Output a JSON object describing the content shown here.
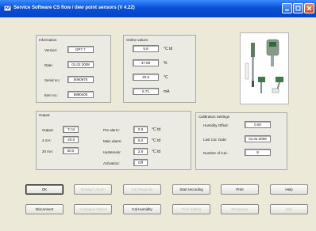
{
  "window": {
    "title": "Service Software CS flow / dew point sensors (V 4.22)"
  },
  "information": {
    "title": "Information",
    "version_label": "Version:",
    "version_value": "DP7.7",
    "date_label": "Date:",
    "date_value": "01.02.2008",
    "serial_label": "Serial no.:",
    "serial_value": "5060975",
    "item_label": "Item no.:",
    "item_value": "6990400"
  },
  "online_values": {
    "title": "Online values",
    "rows": [
      {
        "value": "5.8",
        "unit": "°C td"
      },
      {
        "value": "37.88",
        "unit": "%"
      },
      {
        "value": "20.8",
        "unit": "°C"
      },
      {
        "value": "5.71",
        "unit": "mA"
      }
    ]
  },
  "output": {
    "title": "Output",
    "output_label": "Output:",
    "output_value": "°C td",
    "ma4_label": "4 mA:",
    "ma4_value": "-20.0",
    "ma20_label": "20 mA:",
    "ma20_value": "50.0",
    "prealarm_label": "Pre alarm:",
    "prealarm_value": "0.8",
    "prealarm_unit": "°C td",
    "mainalarm_label": "Main alarm:",
    "mainalarm_value": "6.0",
    "mainalarm_unit": "°C td",
    "hysteresis_label": "Hysteresis:",
    "hysteresis_value": "2.8",
    "hysteresis_unit": "°C td",
    "activation_label": "Activation:",
    "activation_value": "Off"
  },
  "calibration": {
    "title": "Calibration Settings",
    "humidity_label": "Humidity Offset:",
    "humidity_value": "0.00",
    "lastcal_label": "Last Cal. Date:",
    "lastcal_value": "01.02.2008",
    "numcal_label": "Number of Cal.:",
    "numcal_value": "8"
  },
  "buttons": {
    "row1": [
      "OK",
      "Display / Alarm",
      "Cal Dewpoint",
      "Start recording",
      "Print",
      "Help"
    ],
    "row2": [
      "Disconnect",
      "Analogue Output",
      "Cal Humidity",
      "Flow Setting",
      "Response",
      "Exit"
    ]
  }
}
